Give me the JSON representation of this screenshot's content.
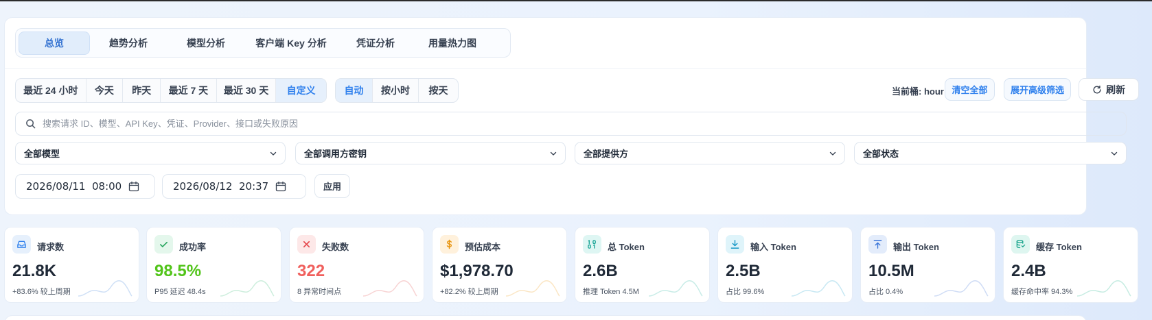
{
  "tabs": [
    "总览",
    "趋势分析",
    "模型分析",
    "客户端 Key 分析",
    "凭证分析",
    "用量热力图"
  ],
  "time_ranges": [
    "最近 24 小时",
    "今天",
    "昨天",
    "最近 7 天",
    "最近 30 天",
    "自定义"
  ],
  "granularity": [
    "自动",
    "按小时",
    "按天"
  ],
  "bucket_text": "当前桶: hour",
  "clear_all": "清空全部",
  "advanced_filter": "展开高级筛选",
  "refresh": "刷新",
  "search": {
    "placeholder": "搜索请求 ID、模型、API Key、凭证、Provider、接口或失败原因"
  },
  "filters": [
    "全部模型",
    "全部调用方密钥",
    "全部提供方",
    "全部状态"
  ],
  "start_date": "2026/08/11  08:00",
  "end_date": "2026/08/12  20:37",
  "apply": "应用",
  "colors": {
    "accent": "#2f80ed",
    "success": "#52c41a",
    "danger": "#f0605d"
  },
  "cards": [
    {
      "label": "请求数",
      "value": "21.8K",
      "sub": "+83.6% 较上周期",
      "icon": "inbox-icon"
    },
    {
      "label": "成功率",
      "value": "98.5%",
      "sub": "P95 延迟 48.4s",
      "icon": "check-icon"
    },
    {
      "label": "失败数",
      "value": "322",
      "sub": "8 异常时间点",
      "icon": "x-icon"
    },
    {
      "label": "预估成本",
      "value": "$1,978.70",
      "sub": "+82.2% 较上周期",
      "icon": "dollar-icon"
    },
    {
      "label": "总 Token",
      "value": "2.6B",
      "sub": "推理 Token 4.5M",
      "icon": "binary-icon"
    },
    {
      "label": "输入 Token",
      "value": "2.5B",
      "sub": "占比 99.6%",
      "icon": "download-icon"
    },
    {
      "label": "输出 Token",
      "value": "10.5M",
      "sub": "占比 0.4%",
      "icon": "upload-icon"
    },
    {
      "label": "缓存 Token",
      "value": "2.4B",
      "sub": "缓存命中率 94.3%",
      "icon": "database-icon"
    }
  ]
}
